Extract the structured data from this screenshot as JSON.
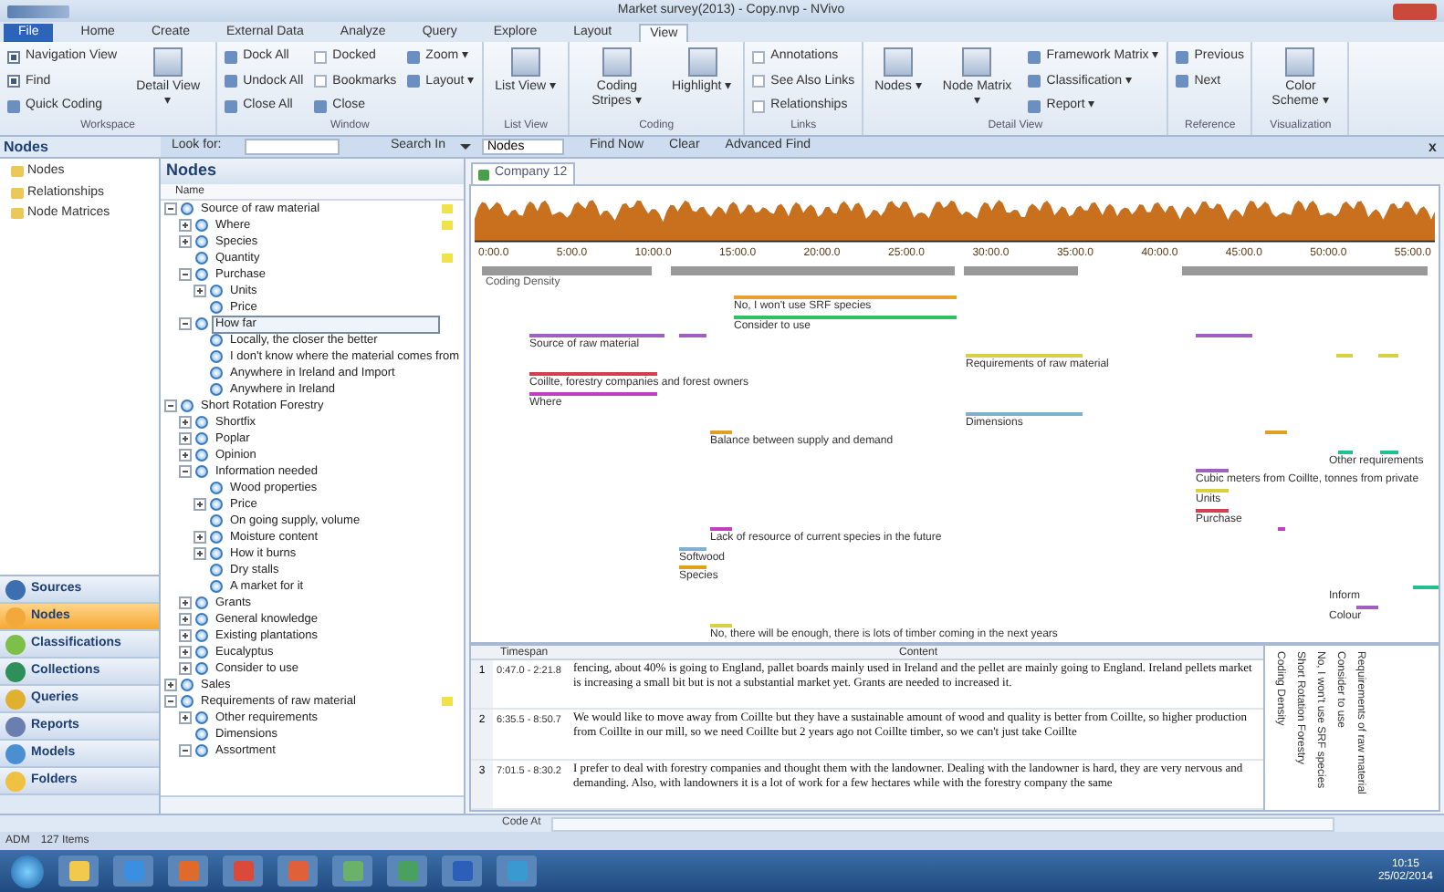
{
  "window": {
    "title": "Market survey(2013) - Copy.nvp - NVivo"
  },
  "ribbon_tabs": [
    {
      "label": "File",
      "selected": false,
      "kind": "file"
    },
    {
      "label": "Home",
      "selected": false,
      "kind": "tab"
    },
    {
      "label": "Create",
      "selected": false,
      "kind": "tab"
    },
    {
      "label": "External Data",
      "selected": false,
      "kind": "tab"
    },
    {
      "label": "Analyze",
      "selected": false,
      "kind": "tab"
    },
    {
      "label": "Query",
      "selected": false,
      "kind": "tab"
    },
    {
      "label": "Explore",
      "selected": false,
      "kind": "tab"
    },
    {
      "label": "Layout",
      "selected": false,
      "kind": "tab"
    },
    {
      "label": "View",
      "selected": true,
      "kind": "tab"
    }
  ],
  "ribbon_groups": [
    {
      "label": "Workspace",
      "columns": [
        [
          {
            "kind": "check",
            "label": "Navigation View",
            "checked": true
          },
          {
            "kind": "check",
            "label": "Find",
            "checked": true
          },
          {
            "kind": "small",
            "label": "Quick Coding"
          }
        ],
        [
          {
            "kind": "large",
            "label": "Detail View ▾"
          }
        ]
      ]
    },
    {
      "label": "Window",
      "columns": [
        [
          {
            "kind": "small",
            "label": "Dock All"
          },
          {
            "kind": "small",
            "label": "Undock All"
          },
          {
            "kind": "small",
            "label": "Close All"
          }
        ],
        [
          {
            "kind": "check",
            "label": "Docked",
            "checked": false
          },
          {
            "kind": "check",
            "label": "Bookmarks",
            "checked": false
          },
          {
            "kind": "small",
            "label": "Close"
          }
        ],
        [
          {
            "kind": "small",
            "label": "Zoom ▾"
          },
          {
            "kind": "small",
            "label": "Layout ▾"
          }
        ]
      ]
    },
    {
      "label": "List View",
      "columns": [
        [
          {
            "kind": "large",
            "label": "List View ▾"
          }
        ]
      ]
    },
    {
      "label": "Coding",
      "columns": [
        [
          {
            "kind": "large",
            "label": "Coding Stripes ▾"
          }
        ],
        [
          {
            "kind": "large",
            "label": "Highlight ▾"
          }
        ]
      ]
    },
    {
      "label": "Links",
      "columns": [
        [
          {
            "kind": "check",
            "label": "Annotations",
            "checked": false
          },
          {
            "kind": "check",
            "label": "See Also Links",
            "checked": false
          },
          {
            "kind": "check",
            "label": "Relationships",
            "checked": false
          }
        ]
      ]
    },
    {
      "label": "Detail View",
      "columns": [
        [
          {
            "kind": "large",
            "label": "Nodes ▾"
          }
        ],
        [
          {
            "kind": "large",
            "label": "Node Matrix ▾"
          }
        ],
        [
          {
            "kind": "small",
            "label": "Framework Matrix ▾"
          },
          {
            "kind": "small",
            "label": "Classification ▾"
          },
          {
            "kind": "small",
            "label": "Report ▾"
          }
        ]
      ]
    },
    {
      "label": "Reference",
      "columns": [
        [
          {
            "kind": "small",
            "label": "Previous"
          },
          {
            "kind": "small",
            "label": "Next"
          }
        ]
      ]
    },
    {
      "label": "Visualization",
      "columns": [
        [
          {
            "kind": "large",
            "label": "Color Scheme ▾"
          }
        ]
      ]
    }
  ],
  "find_bar": {
    "look_for_label": "Look for:",
    "search_in_label": "Search In",
    "search_in_value": "Nodes",
    "buttons": [
      "Find Now",
      "Clear",
      "Advanced Find"
    ],
    "close": "x"
  },
  "navigation": {
    "title": "Nodes",
    "folders": [
      {
        "label": "Nodes",
        "selected": false
      },
      {
        "label": "Relationships",
        "selected": false
      },
      {
        "label": "Node Matrices",
        "selected": false
      }
    ],
    "sections": [
      {
        "label": "Sources",
        "selected": false
      },
      {
        "label": "Nodes",
        "selected": true
      },
      {
        "label": "Classifications",
        "selected": false
      },
      {
        "label": "Collections",
        "selected": false
      },
      {
        "label": "Queries",
        "selected": false
      },
      {
        "label": "Reports",
        "selected": false
      },
      {
        "label": "Models",
        "selected": false
      },
      {
        "label": "Folders",
        "selected": false
      }
    ]
  },
  "node_list": {
    "title": "Nodes",
    "column": "Name",
    "nodes": [
      {
        "label": "Source of raw material",
        "expanded": true,
        "selected": false,
        "flagged": true,
        "children": [
          {
            "label": "Where",
            "expanded": false,
            "selected": false,
            "flagged": true
          },
          {
            "label": "Species",
            "expanded": false,
            "selected": false,
            "flagged": false
          },
          {
            "label": "Quantity",
            "selected": false,
            "flagged": true
          },
          {
            "label": "Purchase",
            "expanded": true,
            "selected": false,
            "flagged": false,
            "children": [
              {
                "label": "Units",
                "expanded": false,
                "selected": false,
                "flagged": false
              },
              {
                "label": "Price",
                "selected": false,
                "flagged": false
              }
            ]
          },
          {
            "label": "How far",
            "expanded": true,
            "selected": true,
            "flagged": false,
            "children": [
              {
                "label": "Locally, the closer the better",
                "selected": false,
                "flagged": false
              },
              {
                "label": "I don't know where the material comes from",
                "selected": false,
                "flagged": false
              },
              {
                "label": "Anywhere in Ireland and Import",
                "selected": false,
                "flagged": false
              },
              {
                "label": "Anywhere in Ireland",
                "selected": false,
                "flagged": false
              }
            ]
          }
        ]
      },
      {
        "label": "Short Rotation Forestry",
        "expanded": true,
        "selected": false,
        "flagged": false,
        "children": [
          {
            "label": "Shortfix",
            "expanded": false,
            "selected": false,
            "flagged": false
          },
          {
            "label": "Poplar",
            "expanded": false,
            "selected": false,
            "flagged": false
          },
          {
            "label": "Opinion",
            "expanded": false,
            "selected": false,
            "flagged": false
          },
          {
            "label": "Information needed",
            "expanded": true,
            "selected": false,
            "flagged": false,
            "children": [
              {
                "label": "Wood properties",
                "selected": false,
                "flagged": false
              },
              {
                "label": "Price",
                "expanded": false,
                "selected": false,
                "flagged": false
              },
              {
                "label": "On going supply, volume",
                "selected": false,
                "flagged": false
              },
              {
                "label": "Moisture content",
                "expanded": false,
                "selected": false,
                "flagged": false
              },
              {
                "label": "How it burns",
                "expanded": false,
                "selected": false,
                "flagged": false
              },
              {
                "label": "Dry stalls",
                "selected": false,
                "flagged": false
              },
              {
                "label": "A market for it",
                "selected": false,
                "flagged": false
              }
            ]
          },
          {
            "label": "Grants",
            "expanded": false,
            "selected": false,
            "flagged": false
          },
          {
            "label": "General knowledge",
            "expanded": false,
            "selected": false,
            "flagged": false
          },
          {
            "label": "Existing plantations",
            "expanded": false,
            "selected": false,
            "flagged": false
          },
          {
            "label": "Eucalyptus",
            "expanded": false,
            "selected": false,
            "flagged": false
          },
          {
            "label": "Consider to use",
            "expanded": false,
            "selected": false,
            "flagged": false
          }
        ]
      },
      {
        "label": "Sales",
        "expanded": false,
        "selected": false,
        "flagged": false
      },
      {
        "label": "Requirements of raw material",
        "expanded": true,
        "selected": false,
        "flagged": true,
        "children": [
          {
            "label": "Other requirements",
            "expanded": false,
            "selected": false,
            "flagged": false
          },
          {
            "label": "Dimensions",
            "selected": false,
            "flagged": false
          },
          {
            "label": "Assortment",
            "expanded": true,
            "selected": false,
            "flagged": false
          }
        ]
      }
    ]
  },
  "detail": {
    "tab": {
      "label": "Company 12",
      "selected": true
    },
    "timeline_labels": [
      "0:00.0",
      "5:00.0",
      "10:00.0",
      "15:00.0",
      "20:00.0",
      "25:00.0",
      "30:00.0",
      "35:00.0",
      "40:00.0",
      "45:00.0",
      "50:00.0",
      "55:00.0"
    ],
    "coding_density_label": "Coding Density",
    "stripes": [
      {
        "label": "No, I won't use SRF species",
        "color": "#e8a030"
      },
      {
        "label": "Consider to use",
        "color": "#30c060"
      },
      {
        "label": "Source of raw material",
        "color": "#a060c0"
      },
      {
        "label": "Requirements of raw material",
        "color": "#d8d040"
      },
      {
        "label": "Coillte, forestry companies and forest owners",
        "color": "#d04050"
      },
      {
        "label": "Where",
        "color": "#c040c0"
      },
      {
        "label": "Dimensions",
        "color": "#80b0d0"
      },
      {
        "label": "Balance between supply and demand",
        "color": "#e0a020"
      },
      {
        "label": "Other requirements",
        "color": "#20c090"
      },
      {
        "label": "Cubic meters from Coillte, tonnes from private",
        "color": "#a060c0"
      },
      {
        "label": "Units",
        "color": "#d8d040"
      },
      {
        "label": "Purchase",
        "color": "#d04050"
      },
      {
        "label": "Lack of resource of current species in the future",
        "color": "#c040c0"
      },
      {
        "label": "Softwood",
        "color": "#80b0d0"
      },
      {
        "label": "Species",
        "color": "#e0a020"
      },
      {
        "label": "Inform",
        "color": "#20c090"
      },
      {
        "label": "Colour",
        "color": "#a060c0"
      },
      {
        "label": "No, there will be enough, there is lots of timber coming in the next years",
        "color": "#d8d040"
      }
    ],
    "table": {
      "columns": [
        "Timespan",
        "Content"
      ],
      "rows": [
        {
          "number": "1",
          "timespan": "0:47.0 - 2:21.8",
          "content": "fencing, about 40% is going to England, pallet boards mainly used in Ireland and the pellet are mainly going to England. Ireland pellets market is increasing a small bit but is not a substantial market yet. Grants are needed to increased it."
        },
        {
          "number": "2",
          "timespan": "6:35.5 - 8:50.7",
          "content": "We would like to move away from Coillte but they have a sustainable amount of wood and quality is better from Coillte, so higher production from Coillte in our mill, so we need Coillte but 2 years ago not Coillte timber, so we can't just take Coillte"
        },
        {
          "number": "3",
          "timespan": "7:01.5 - 8:30.2",
          "content": "I prefer to deal with forestry companies and thought them with the landowner. Dealing with the landowner is hard, they are very nervous and demanding. Also, with landowners it is a lot of work for a few hectares while with the forestry company the same"
        }
      ]
    },
    "side_stripe_labels": [
      "Coding Density",
      "Short Rotation Forestry",
      "No, I won't use SRF species",
      "Consider to use",
      "Requirements of raw material"
    ]
  },
  "code_bar": {
    "label": "Code At"
  },
  "status_bar": {
    "user": "ADM",
    "items": "127 Items"
  },
  "taskbar": {
    "time": "10:15",
    "date": "25/02/2014"
  }
}
